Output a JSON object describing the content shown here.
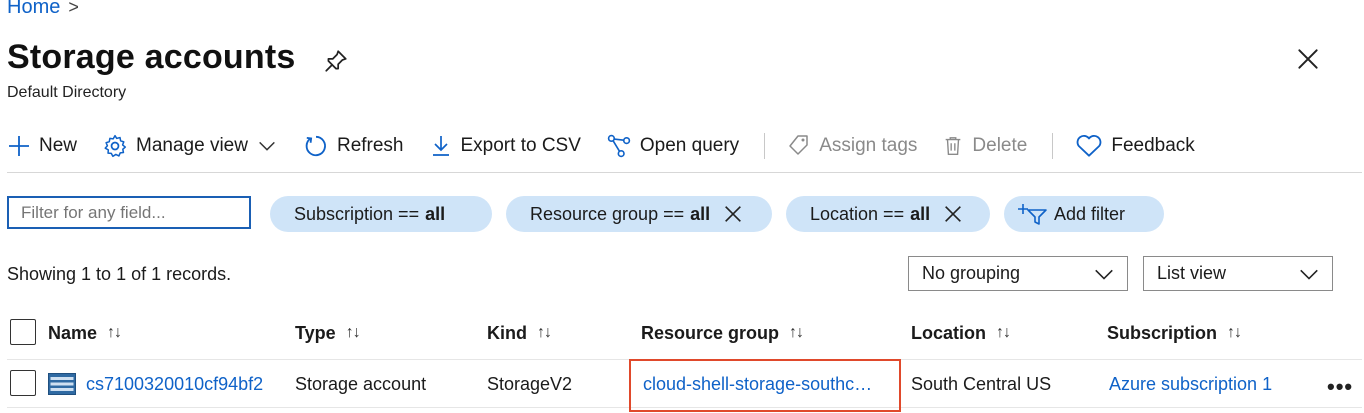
{
  "breadcrumb": {
    "home": "Home",
    "separator": ">"
  },
  "header": {
    "title": "Storage accounts",
    "subtitle": "Default Directory"
  },
  "toolbar": {
    "new": "New",
    "manage_view": "Manage view",
    "refresh": "Refresh",
    "export_csv": "Export to CSV",
    "open_query": "Open query",
    "assign_tags": "Assign tags",
    "delete": "Delete",
    "feedback": "Feedback"
  },
  "filters": {
    "search_placeholder": "Filter for any field...",
    "subscription": {
      "label": "Subscription ==",
      "value": "all"
    },
    "resource_group": {
      "label": "Resource group ==",
      "value": "all"
    },
    "location": {
      "label": "Location ==",
      "value": "all"
    },
    "add_filter": "Add filter"
  },
  "records": {
    "summary": "Showing 1 to 1 of 1 records.",
    "grouping": "No grouping",
    "view": "List view"
  },
  "table": {
    "columns": [
      "Name",
      "Type",
      "Kind",
      "Resource group",
      "Location",
      "Subscription"
    ],
    "sort_glyph": "↑↓",
    "rows": [
      {
        "name": "cs7100320010cf94bf2",
        "type": "Storage account",
        "kind": "StorageV2",
        "resource_group": "cloud-shell-storage-southc…",
        "location": "South Central US",
        "subscription": "Azure subscription 1"
      }
    ],
    "more_glyph": "•••"
  },
  "colors": {
    "accent": "#0f62c8",
    "pill_bg": "#cfe4f8",
    "highlight": "#e0492b"
  }
}
